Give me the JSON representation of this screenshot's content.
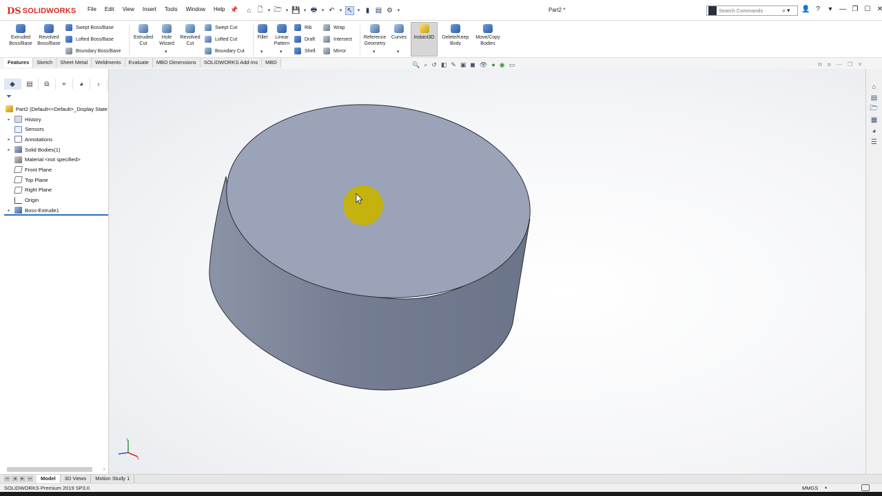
{
  "app": {
    "logo_ds": "DS",
    "logo_text": "SOLIDWORKS",
    "doc_title": "Part2 *"
  },
  "menu": [
    "File",
    "Edit",
    "View",
    "Insert",
    "Tools",
    "Window",
    "Help"
  ],
  "search": {
    "placeholder": "Search Commands"
  },
  "ribbon": {
    "extruded_boss": "Extruded Boss/Base",
    "revolved_boss": "Revolved Boss/Base",
    "swept_boss": "Swept Boss/Base",
    "lofted_boss": "Lofted Boss/Base",
    "boundary_boss": "Boundary Boss/Base",
    "extruded_cut": "Extruded Cut",
    "hole_wizard": "Hole Wizard",
    "revolved_cut": "Revolved Cut",
    "swept_cut": "Swept Cut",
    "lofted_cut": "Lofted Cut",
    "boundary_cut": "Boundary Cut",
    "fillet": "Fillet",
    "linear_pattern": "Linear Pattern",
    "rib": "Rib",
    "draft": "Draft",
    "shell": "Shell",
    "wrap": "Wrap",
    "intersect": "Intersect",
    "mirror": "Mirror",
    "reference_geometry": "Reference Geometry",
    "curves": "Curves",
    "instant3d": "Instant3D",
    "delete_keep_body": "Delete/Keep Body",
    "move_copy_bodies": "Move/Copy Bodies"
  },
  "tabs": [
    "Features",
    "Sketch",
    "Sheet Metal",
    "Weldments",
    "Evaluate",
    "MBD Dimensions",
    "SOLIDWORKS Add-Ins",
    "MBD"
  ],
  "tree": [
    {
      "label": "Part2  (Default<<Default>_Display State",
      "icon": "part-icon",
      "toggle": ""
    },
    {
      "label": "History",
      "icon": "history-folder-icon",
      "toggle": "▸"
    },
    {
      "label": "Sensors",
      "icon": "sensors-icon",
      "toggle": ""
    },
    {
      "label": "Annotations",
      "icon": "annotations-icon",
      "toggle": "▸"
    },
    {
      "label": "Solid Bodies(1)",
      "icon": "solid-bodies-icon",
      "toggle": "▸"
    },
    {
      "label": "Material <not specified>",
      "icon": "material-icon",
      "toggle": ""
    },
    {
      "label": "Front Plane",
      "icon": "plane-icon",
      "toggle": ""
    },
    {
      "label": "Top Plane",
      "icon": "plane-icon",
      "toggle": ""
    },
    {
      "label": "Right Plane",
      "icon": "plane-icon",
      "toggle": ""
    },
    {
      "label": "Origin",
      "icon": "origin-icon",
      "toggle": ""
    },
    {
      "label": "Boss-Extrude1",
      "icon": "boss-extrude-icon",
      "toggle": "▸"
    }
  ],
  "bottom_tabs": [
    "Model",
    "3D Views",
    "Motion Study 1"
  ],
  "status": {
    "text": "SOLIDWORKS Premium 2019 SP3.0",
    "units": "MMGS"
  },
  "colors": {
    "brand_red": "#d52b1e",
    "model_top": "#9aa3b8",
    "model_side": "#747d92",
    "cursor_highlight": "#c8b400"
  }
}
